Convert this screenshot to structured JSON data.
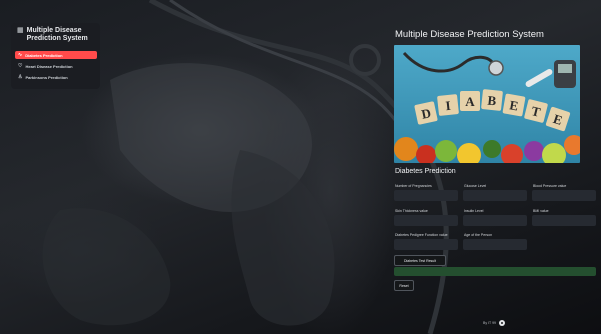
{
  "app": {
    "title": "Multiple Disease Prediction System",
    "accent_color": "#ff4b4b"
  },
  "sidebar": {
    "header_icon": "hospital-icon",
    "header_title": "Multiple Disease Prediction System",
    "items": [
      {
        "icon": "activity-icon",
        "label": "Diabetes Prediction",
        "active": true
      },
      {
        "icon": "heart-icon",
        "label": "Heart Disease Prediction",
        "active": false
      },
      {
        "icon": "person-icon",
        "label": "Parkinsons Prediction",
        "active": false
      }
    ]
  },
  "main": {
    "title": "Multiple Disease Prediction System",
    "banner_alt": "diabetes-image",
    "banner_word": [
      "D",
      "I",
      "A",
      "B",
      "E",
      "T",
      "E",
      "S"
    ],
    "section_title": "Diabetes Prediction",
    "fields": [
      {
        "label": "Number of Pregnancies",
        "value": ""
      },
      {
        "label": "Glucose Level",
        "value": ""
      },
      {
        "label": "Blood Pressure value",
        "value": ""
      },
      {
        "label": "Skin Thickness value",
        "value": ""
      },
      {
        "label": "Insulin Level",
        "value": ""
      },
      {
        "label": "BMI value",
        "value": ""
      },
      {
        "label": "Diabetes Pedigree Function value",
        "value": ""
      },
      {
        "label": "Age of the Person",
        "value": ""
      }
    ],
    "submit_label": "Diabetes Test Result",
    "result_color": "#244f2f",
    "reset_label": "Reset"
  },
  "footer": {
    "text": "By IT 99",
    "icon": "github-icon"
  }
}
